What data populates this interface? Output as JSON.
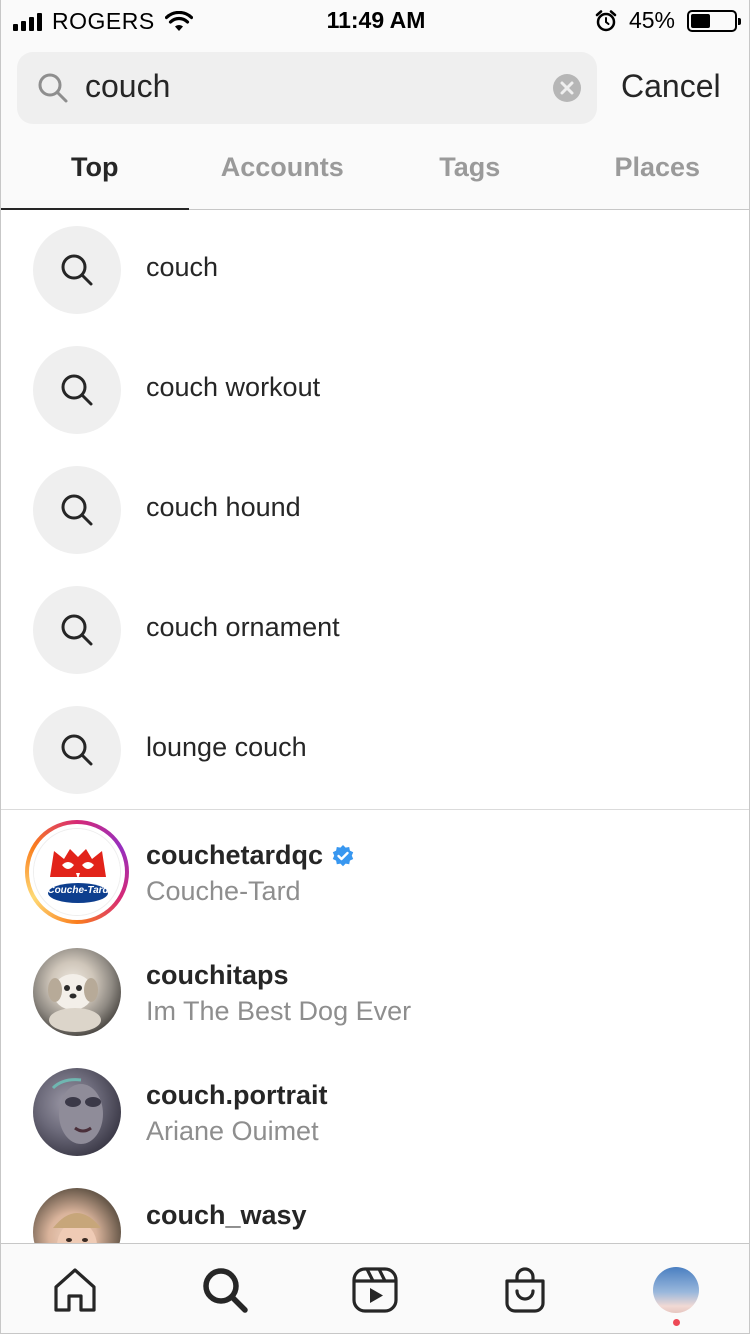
{
  "status_bar": {
    "carrier": "ROGERS",
    "time": "11:49 AM",
    "battery_percent": "45%",
    "battery_level": 0.45,
    "icons": [
      "signal-bars-icon",
      "wifi-icon",
      "alarm-icon",
      "battery-icon"
    ]
  },
  "search": {
    "value": "couch",
    "cancel_label": "Cancel",
    "icons": [
      "search-icon",
      "clear-icon"
    ]
  },
  "tabs": [
    {
      "label": "Top",
      "active": true
    },
    {
      "label": "Accounts",
      "active": false
    },
    {
      "label": "Tags",
      "active": false
    },
    {
      "label": "Places",
      "active": false
    }
  ],
  "suggestions": [
    {
      "label": "couch"
    },
    {
      "label": "couch workout"
    },
    {
      "label": "couch hound"
    },
    {
      "label": "couch ornament"
    },
    {
      "label": "lounge couch"
    }
  ],
  "accounts": [
    {
      "username": "couchetardqc",
      "full_name": "Couche-Tard",
      "verified": true,
      "has_story": true,
      "logo_text": "Couche-Tard"
    },
    {
      "username": "couchitaps",
      "full_name": "Im The Best Dog Ever",
      "verified": false,
      "has_story": false
    },
    {
      "username": "couch.portrait",
      "full_name": "Ariane Ouimet",
      "verified": false,
      "has_story": false
    },
    {
      "username": "couch_wasy",
      "full_name": "",
      "verified": false,
      "has_story": false
    }
  ],
  "bottom_nav": {
    "items": [
      "home-icon",
      "search-icon",
      "reels-icon",
      "shop-icon",
      "profile-avatar"
    ],
    "active": "search-icon",
    "notification_dot_color": "#ed4956"
  },
  "colors": {
    "accent_verified": "#3897f0",
    "text_primary": "#262626",
    "text_secondary": "#8e8e8e",
    "brand_red": "#e2231a"
  }
}
